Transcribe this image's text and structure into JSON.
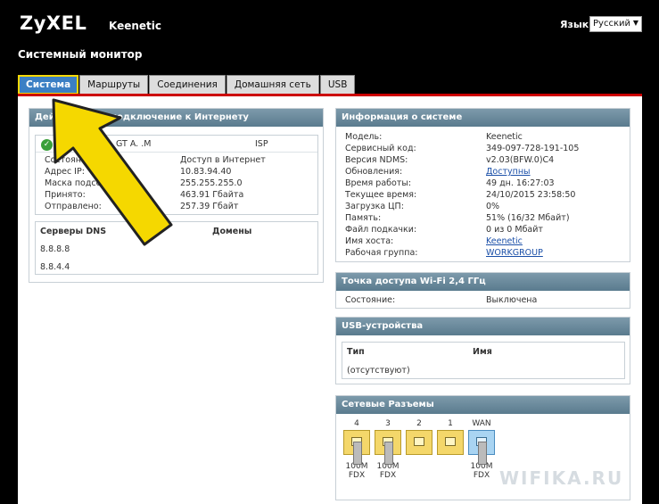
{
  "header": {
    "logo": "ZyXEL",
    "model": "Keenetic",
    "lang_label": "Язык:",
    "lang_value": "Русский"
  },
  "page_title": "Системный монитор",
  "tabs": [
    "Система",
    "Маршруты",
    "Соединения",
    "Домашняя сеть",
    "USB"
  ],
  "internet": {
    "title": "Действующее подключение к Интернету",
    "conn_name": "GT A. .M",
    "conn_type": "ISP",
    "rows": [
      {
        "label": "Состояние:",
        "value": "Доступ в Интернет"
      },
      {
        "label": "Адрес IP:",
        "value": "10.83.94.40"
      },
      {
        "label": "Маска подсети:",
        "value": "255.255.255.0"
      },
      {
        "label": "Принято:",
        "value": "463.91 Гбайта"
      },
      {
        "label": "Отправлено:",
        "value": "257.39 Гбайт"
      }
    ],
    "dns_header": "Серверы DNS",
    "domains_header": "Домены",
    "dns": [
      "8.8.8.8",
      "8.8.4.4"
    ]
  },
  "sysinfo": {
    "title": "Информация о системе",
    "rows": [
      {
        "label": "Модель:",
        "value": "Keenetic"
      },
      {
        "label": "Сервисный код:",
        "value": "349-097-728-191-105"
      },
      {
        "label": "Версия NDMS:",
        "value": "v2.03(BFW.0)C4"
      },
      {
        "label": "Обновления:",
        "value": "Доступны"
      },
      {
        "label": "Время работы:",
        "value": "49 дн. 16:27:03"
      },
      {
        "label": "Текущее время:",
        "value": "24/10/2015 23:58:50"
      },
      {
        "label": "Загрузка ЦП:",
        "value": "0%"
      },
      {
        "label": "Память:",
        "value": "51% (16/32 Мбайт)"
      },
      {
        "label": "Файл подкачки:",
        "value": "0 из 0 Мбайт"
      },
      {
        "label": "Имя хоста:",
        "value": "Keenetic"
      },
      {
        "label": "Рабочая группа:",
        "value": "WORKGROUP"
      }
    ]
  },
  "wifi": {
    "title": "Точка доступа Wi-Fi 2,4 ГГц",
    "label": "Состояние:",
    "value": "Выключена"
  },
  "usb": {
    "title": "USB-устройства",
    "col_type": "Тип",
    "col_name": "Имя",
    "empty": "(отсутствуют)"
  },
  "ports": {
    "title": "Сетевые Разъемы",
    "items": [
      {
        "name": "4",
        "speed": "100M",
        "duplex": "FDX"
      },
      {
        "name": "3",
        "speed": "100M",
        "duplex": "FDX"
      },
      {
        "name": "2",
        "speed": "",
        "duplex": ""
      },
      {
        "name": "1",
        "speed": "",
        "duplex": ""
      },
      {
        "name": "WAN",
        "speed": "100M",
        "duplex": "FDX"
      }
    ]
  },
  "watermark": "WIFIKA.RU"
}
